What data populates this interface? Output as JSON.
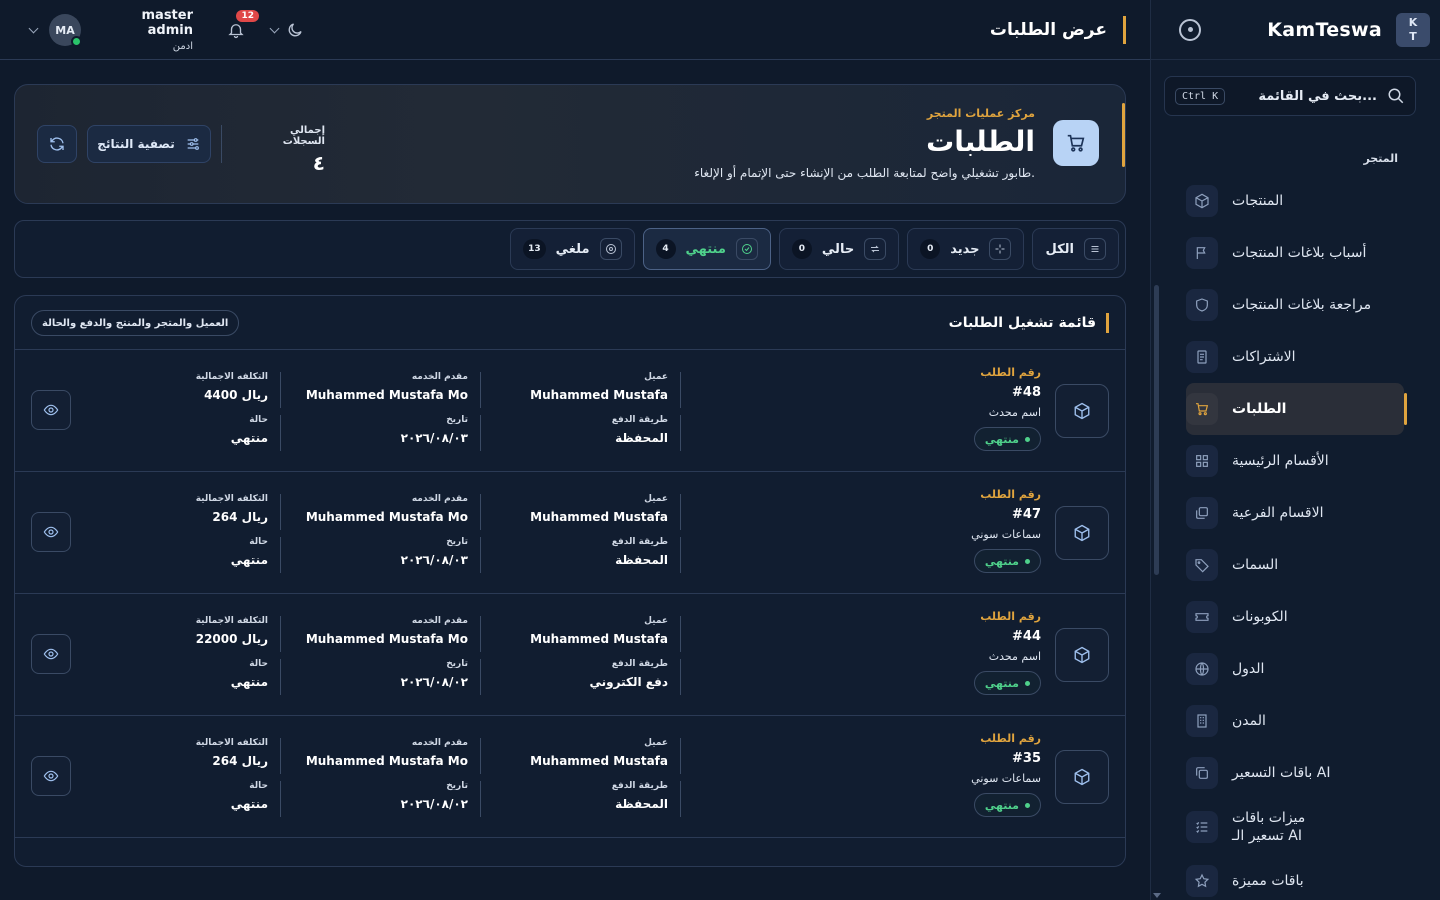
{
  "app": {
    "brand": "KamTeswa",
    "logo_lines": [
      "K",
      "T"
    ]
  },
  "search": {
    "placeholder": "بحث في القائمة...",
    "shortcut": "Ctrl K"
  },
  "sidebar": {
    "section_label": "المتجر",
    "items": [
      {
        "label": "المنتجات",
        "icon": "box-icon"
      },
      {
        "label": "أسباب بلاغات المنتجات",
        "icon": "flag-icon"
      },
      {
        "label": "مراجعة بلاغات المنتجات",
        "icon": "shield-icon"
      },
      {
        "label": "الاشتراكات",
        "icon": "receipt-icon"
      },
      {
        "label": "الطلبات",
        "icon": "cart-icon",
        "active": true
      },
      {
        "label": "الأقسام الرئيسية",
        "icon": "grid-icon"
      },
      {
        "label": "الاقسام الفرعية",
        "icon": "layers-icon"
      },
      {
        "label": "السمات",
        "icon": "tag-icon"
      },
      {
        "label": "الكوبونات",
        "icon": "ticket-icon"
      },
      {
        "label": "الدول",
        "icon": "globe-icon"
      },
      {
        "label": "المدن",
        "icon": "building-icon"
      },
      {
        "label": "باقات التسعير AI",
        "icon": "copy-icon"
      },
      {
        "label": "ميزات باقات تسعير الـ AI",
        "icon": "checklist-icon"
      },
      {
        "label": "باقات مميزة",
        "icon": "star-icon"
      }
    ]
  },
  "topbar": {
    "title": "عرض الطلبات",
    "user": {
      "name": "master admin",
      "role": "ادمن",
      "initials": "MA"
    },
    "notifications": "12"
  },
  "hero": {
    "kicker": "مركز عمليات المتجر",
    "title": "الطلبات",
    "description": "طابور تشغيلي واضح لمتابعة الطلب من الإنشاء حتى الإتمام أو الإلغاء.",
    "total_label": "إجمالي السجلات",
    "total_value": "٤",
    "filter_label": "تصفية النتائج"
  },
  "tabs": [
    {
      "label": "الكل",
      "count": "",
      "icon": "list-icon"
    },
    {
      "label": "جديد",
      "count": "0",
      "icon": "sparkle-icon"
    },
    {
      "label": "حالي",
      "count": "0",
      "icon": "repeat-icon"
    },
    {
      "label": "منتهي",
      "count": "4",
      "icon": "check-circle-icon",
      "active": true
    },
    {
      "label": "ملغي",
      "count": "13",
      "icon": "x-circle-icon"
    }
  ],
  "list": {
    "title": "قائمة تشغيل الطلبات",
    "chip": "العميل والمتجر والمنتج والدفع والحالة",
    "labels": {
      "order_number": "رقم الطلب",
      "client": "عميل",
      "provider": "مقدم الخدمه",
      "total": "التكلفه الاجمالية",
      "payment": "طريقة الدفع",
      "date": "تاريخ",
      "status": "حالة"
    },
    "rows": [
      {
        "number": "#48",
        "product": "اسم محدث",
        "pill": "منتهي",
        "client": "Muhammed Mustafa",
        "provider": "Muhammed Mustafa Mo",
        "total": "4400 ريال",
        "payment": "المحفظة",
        "date": "٢٠٢٦/٠٨/٠٣",
        "status": "منتهي"
      },
      {
        "number": "#47",
        "product": "سماعات سوني",
        "pill": "منتهي",
        "client": "Muhammed Mustafa",
        "provider": "Muhammed Mustafa Mo",
        "total": "264 ريال",
        "payment": "المحفظة",
        "date": "٢٠٢٦/٠٨/٠٣",
        "status": "منتهي"
      },
      {
        "number": "#44",
        "product": "اسم محدث",
        "pill": "منتهي",
        "client": "Muhammed Mustafa",
        "provider": "Muhammed Mustafa Mo",
        "total": "22000 ريال",
        "payment": "دفع الكتروني",
        "date": "٢٠٢٦/٠٨/٠٢",
        "status": "منتهي"
      },
      {
        "number": "#35",
        "product": "سماعات سوني",
        "pill": "منتهي",
        "client": "Muhammed Mustafa",
        "provider": "Muhammed Mustafa Mo",
        "total": "264 ريال",
        "payment": "المحفظة",
        "date": "٢٠٢٦/٠٨/٠٢",
        "status": "منتهي"
      }
    ]
  },
  "colors": {
    "accent": "#e0a43e",
    "success": "#4fd18b",
    "danger": "#e04848",
    "background": "#0f1a2b"
  }
}
